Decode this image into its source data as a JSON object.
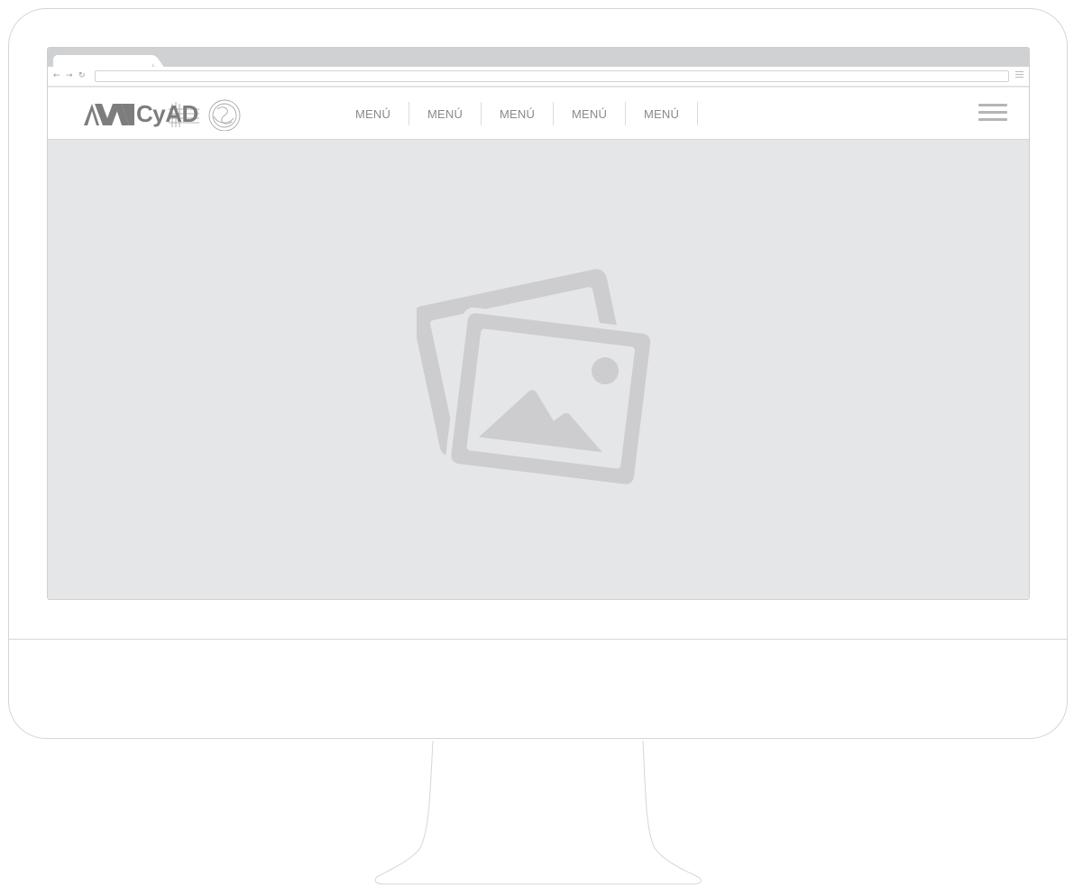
{
  "browser": {
    "back_icon": "←",
    "forward_icon": "→",
    "reload_icon": "↻",
    "url": ""
  },
  "site": {
    "logo_text": "CyAD",
    "nav_items": [
      "MENÚ",
      "MENÚ",
      "MENÚ",
      "MENÚ",
      "MENÚ"
    ]
  },
  "hero": {
    "icon": "image-placeholder-icon"
  },
  "colors": {
    "frame_border": "#d6d6d6",
    "hero_background": "#e5e6e8",
    "placeholder_icon": "#cdcdcf",
    "menu_text": "#8a8a8a"
  }
}
